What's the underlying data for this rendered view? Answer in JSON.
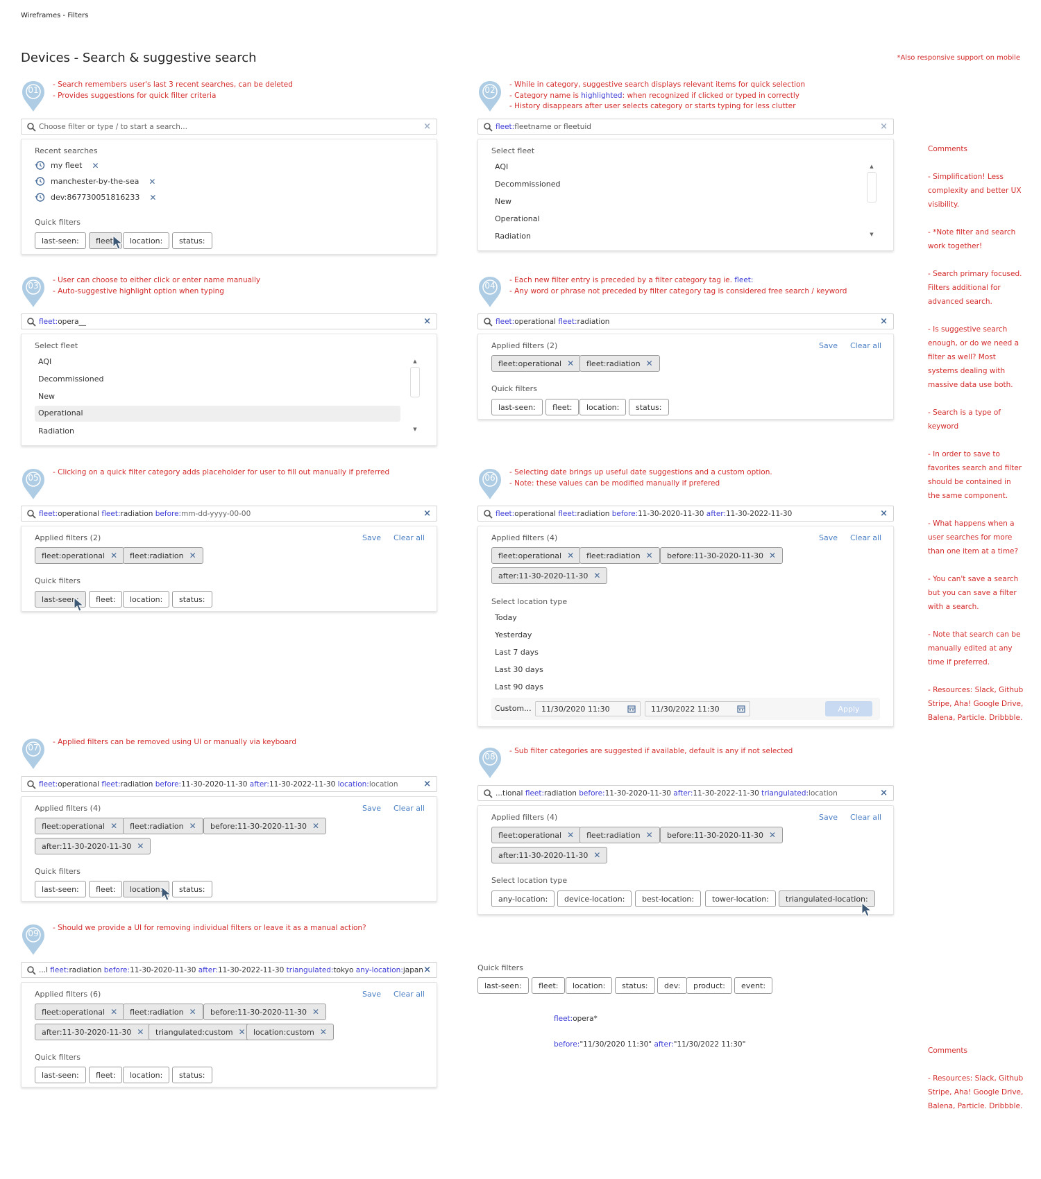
{
  "header": {
    "breadcrumb": "Wireframes - Filters",
    "title": "Devices - Search & suggestive search",
    "responsive_note": "*Also responsive support on mobile"
  },
  "common": {
    "save": "Save",
    "clear_all": "Clear all",
    "quick_filters": "Quick filters",
    "select_fleet": "Select fleet",
    "select_location_type": "Select location type",
    "apply": "Apply",
    "custom": "Custom...",
    "clear": "×"
  },
  "quick_filter_chips": [
    "last-seen:",
    "fleet:",
    "location:",
    "status:"
  ],
  "fleet_options": [
    "AQI",
    "Decommissioned",
    "New",
    "Operational",
    "Radiation"
  ],
  "s01": {
    "num": "01",
    "notes": [
      "- Search remembers user's last 3 recent searches, can be deleted",
      "- Provides suggestions for quick filter criteria"
    ],
    "placeholder": "Choose filter or type / to start a search...",
    "recent_label": "Recent searches",
    "recent": [
      "my fleet",
      "manchester-by-the-sea",
      "dev:867730051816233"
    ]
  },
  "s02": {
    "num": "02",
    "notes": [
      "- While in category, suggestive search displays relevant items for quick selection",
      "- Category name is ",
      "highlighted",
      ": when recognized if clicked or typed in correctly",
      "- History disappears after user selects category or starts typing for less clutter"
    ],
    "key": "fleet:",
    "rest": "fleetname or fleetuid"
  },
  "s03": {
    "num": "03",
    "notes": [
      "- User can choose to either click or enter name manually",
      "- Auto-suggestive highlight option when typing"
    ],
    "key": "fleet:",
    "rest": "opera__"
  },
  "s04": {
    "num": "04",
    "notes": [
      "- Each new filter entry is preceded by a filter category tag ie. ",
      "fleet:",
      "- Any word or phrase not preceded by filter category tag is considered free search / keyword"
    ],
    "applied_label": "Applied filters (2)",
    "applied": [
      "fleet:operational",
      "fleet:radiation"
    ]
  },
  "s05": {
    "num": "05",
    "notes": [
      "- Clicking on a quick filter category adds placeholder for user to fill out manually if preferred"
    ],
    "tail": "mm-dd-yyyy-00-00",
    "applied_label": "Applied filters (2)"
  },
  "s06": {
    "num": "06",
    "notes": [
      "- Selecting date brings up useful date suggestions and a custom option.",
      "- Note: these values can be modified manually if prefered"
    ],
    "before_val": "11-30-2020-11-30",
    "after_val": "11-30-2022-11-30",
    "applied_label": "Applied filters (4)",
    "applied": [
      "fleet:operational",
      "fleet:radiation",
      "before:11-30-2020-11-30",
      "after:11-30-2020-11-30"
    ],
    "date_options": [
      "Today",
      "Yesterday",
      "Last 7 days",
      "Last 30 days",
      "Last 90 days"
    ],
    "from": "11/30/2020 11:30",
    "to": "11/30/2022 11:30"
  },
  "s07": {
    "num": "07",
    "notes": [
      "- Applied filters can be removed using UI or manually via keyboard"
    ],
    "loc_val": "location",
    "applied_label": "Applied filters (4)"
  },
  "s08": {
    "num": "08",
    "notes": [
      "- Sub filter categories are suggested if available, default is any if not selected"
    ],
    "prefix": "...tional ",
    "loc_val": "location",
    "applied_label": "Applied filters (4)",
    "loc_types": [
      "any-location:",
      "device-location:",
      "best-location:",
      "tower-location:",
      "triangulated-location:"
    ]
  },
  "s09": {
    "num": "09",
    "notes": [
      "- Should we provide a UI for removing individual filters or leave it as a manual action?"
    ],
    "prefix": "...l ",
    "tri_val": "tokyo",
    "any_val": "japan",
    "applied_label": "Applied filters (6)",
    "applied": [
      "fleet:operational",
      "fleet:radiation",
      "before:11-30-2020-11-30",
      "after:11-30-2020-11-30",
      "triangulated:custom",
      "location:custom"
    ]
  },
  "keys": {
    "fleet": "fleet:",
    "before": "before:",
    "after": "after:",
    "location": "location:",
    "triangulated": "triangulated:",
    "any_location": "any-location:",
    "operational": "operational",
    "radiation": "radiation"
  },
  "extra_quick": {
    "label": "Quick filters",
    "chips": [
      "last-seen:",
      "fleet:",
      "location:",
      "status:",
      "dev:",
      "product:",
      "event:"
    ]
  },
  "examples": {
    "ex1_val": "opera*",
    "ex2_before": "\"11/30/2020 11:30\"",
    "ex2_after": "\"11/30/2022 11:30\""
  },
  "comments": {
    "title": "Comments",
    "items": [
      "- Simplification! Less complexity and better UX visibility.",
      "- *Note filter and search work together!",
      "- Search primary focused. Filters additional for advanced search.",
      "- Is suggestive search enough, or do we need a filter as well? Most systems dealing with massive data use both.",
      "- Search is a type of keyword",
      "- In order to save to favorites search and filter should be contained in the same component.",
      "- What happens when a user searches for more than one item at a time?",
      "- You can't save a search but you can save a filter with a search.",
      "- Note that search can be manually edited at any time if preferred.",
      "- Resources: Slack, Github Stripe, Aha! Google Drive, Balena, Particle. Dribbble."
    ],
    "bottom_title": "Comments",
    "bottom_item": "- Resources: Slack, Github Stripe, Aha! Google Drive, Balena, Particle. Dribbble."
  },
  "colors": {
    "accent": "#3b3bd6",
    "note_red": "#d42b2b",
    "link": "#4a7fc4",
    "pin": "#aecde4"
  }
}
